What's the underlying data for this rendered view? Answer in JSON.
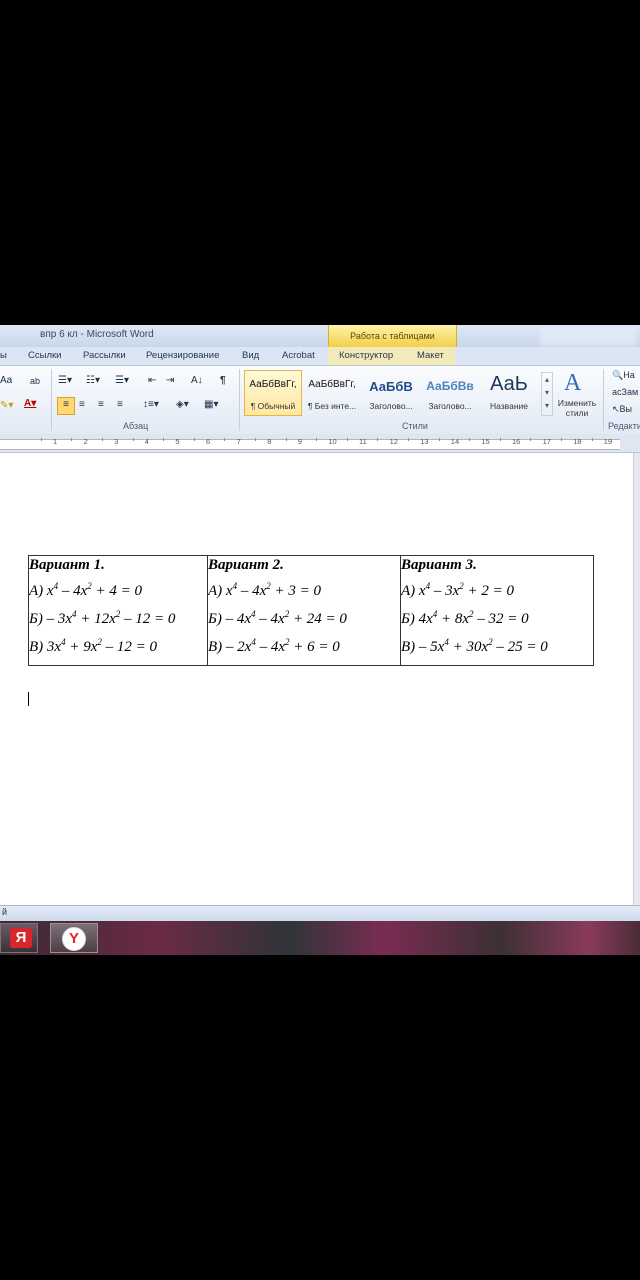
{
  "window": {
    "title": "впр 6 кл  -  Microsoft Word",
    "context_tab_group": "Работа с таблицами"
  },
  "tabs": [
    {
      "label": "ы"
    },
    {
      "label": "Ссылки"
    },
    {
      "label": "Рассылки"
    },
    {
      "label": "Рецензирование"
    },
    {
      "label": "Вид"
    },
    {
      "label": "Acrobat"
    },
    {
      "label": "Конструктор"
    },
    {
      "label": "Макет"
    }
  ],
  "ribbon": {
    "font_button": "Aa",
    "paragraph_mark": "¶",
    "paragraph_group": "Абзац",
    "styles_group": "Стили",
    "editing_group": "Редакти",
    "change_styles": [
      "Изменить",
      "стили"
    ],
    "styles": [
      {
        "sample": "АаБбВвГг,",
        "name": "¶ Обычный"
      },
      {
        "sample": "АаБбВвГг,",
        "name": "¶ Без инте..."
      },
      {
        "sample": "АаБбВ",
        "name": "Заголово..."
      },
      {
        "sample": "АаБбВв",
        "name": "Заголово..."
      },
      {
        "sample": "АаЬ",
        "name": "Название"
      }
    ],
    "editing_items": [
      "На",
      "Зам",
      "Вы"
    ],
    "accent_color": "#e3b743"
  },
  "ruler": {
    "ticks": [
      "1",
      "2",
      "3",
      "4",
      "5",
      "6",
      "7",
      "8",
      "9",
      "10",
      "11",
      "12",
      "13",
      "14",
      "15",
      "16",
      "17",
      "18",
      "19"
    ]
  },
  "document": {
    "variants": [
      {
        "title": "Вариант 1.",
        "equations": [
          [
            "А) x",
            "4",
            " – 4x",
            "2",
            " + 4 = 0"
          ],
          [
            "Б) – 3x",
            "4",
            " + 12x",
            "2",
            " – 12 = 0"
          ],
          [
            "В) 3x",
            "4",
            " + 9x",
            "2",
            " – 12 = 0"
          ]
        ]
      },
      {
        "title": "Вариант 2.",
        "equations": [
          [
            "А) x",
            "4",
            " – 4x",
            "2",
            " + 3 = 0"
          ],
          [
            "Б) – 4x",
            "4",
            " – 4x",
            "2",
            " + 24 = 0"
          ],
          [
            "В) – 2x",
            "4",
            " – 4x",
            "2",
            " + 6 = 0"
          ]
        ]
      },
      {
        "title": "Вариант 3.",
        "equations": [
          [
            "А) x",
            "4",
            " – 3x",
            "2",
            " + 2 = 0"
          ],
          [
            "Б) 4x",
            "4",
            " + 8x",
            "2",
            " – 32 = 0"
          ],
          [
            "В) – 5x",
            "4",
            " + 30x",
            "2",
            " – 25 = 0"
          ]
        ]
      }
    ]
  },
  "statusbar": {
    "text": "й"
  },
  "taskbar": {
    "yandex_label": "Я",
    "browser_label": "Y"
  }
}
